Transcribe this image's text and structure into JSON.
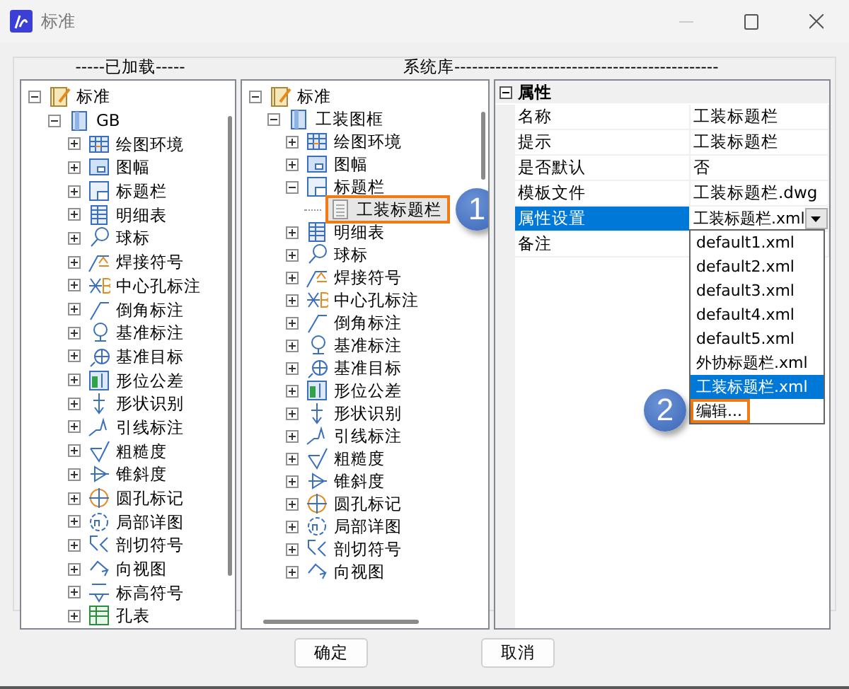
{
  "window": {
    "title": "标准"
  },
  "loaded": {
    "label": "-----已加载-----",
    "tree": [
      {
        "label": "标准",
        "expanded": true,
        "selected": false,
        "children": [
          {
            "label": "GB",
            "expanded": true,
            "selected": false,
            "children": [
              {
                "label": "绘图环境",
                "expanded": false,
                "selected": false
              },
              {
                "label": "图幅",
                "expanded": false,
                "selected": false
              },
              {
                "label": "标题栏",
                "expanded": false,
                "selected": false
              },
              {
                "label": "明细表",
                "expanded": false,
                "selected": false
              },
              {
                "label": "球标",
                "expanded": false,
                "selected": false
              },
              {
                "label": "焊接符号",
                "expanded": false,
                "selected": false
              },
              {
                "label": "中心孔标注",
                "expanded": false,
                "selected": false
              },
              {
                "label": "倒角标注",
                "expanded": false,
                "selected": false
              },
              {
                "label": "基准标注",
                "expanded": false,
                "selected": false
              },
              {
                "label": "基准目标",
                "expanded": false,
                "selected": false
              },
              {
                "label": "形位公差",
                "expanded": false,
                "selected": false
              },
              {
                "label": "形状识别",
                "expanded": false,
                "selected": false
              },
              {
                "label": "引线标注",
                "expanded": false,
                "selected": false
              },
              {
                "label": "粗糙度",
                "expanded": false,
                "selected": false
              },
              {
                "label": "锥斜度",
                "expanded": false,
                "selected": false
              },
              {
                "label": "圆孔标记",
                "expanded": false,
                "selected": false
              },
              {
                "label": "局部详图",
                "expanded": false,
                "selected": false
              },
              {
                "label": "剖切符号",
                "expanded": false,
                "selected": false
              },
              {
                "label": "向视图",
                "expanded": false,
                "selected": false
              },
              {
                "label": "标高符号",
                "expanded": false,
                "selected": false
              },
              {
                "label": "孔表",
                "expanded": false,
                "selected": false
              }
            ]
          }
        ]
      }
    ]
  },
  "library": {
    "label": "系统库---------------------------------------------",
    "tree": [
      {
        "label": "标准",
        "expanded": true,
        "selected": false,
        "children": [
          {
            "label": "工装图框",
            "expanded": true,
            "selected": false,
            "children": [
              {
                "label": "绘图环境",
                "expanded": false,
                "selected": false
              },
              {
                "label": "图幅",
                "expanded": false,
                "selected": false
              },
              {
                "label": "标题栏",
                "expanded": true,
                "selected": false,
                "children": [
                  {
                    "label": "工装标题栏",
                    "selected": true,
                    "callout": "1"
                  }
                ]
              },
              {
                "label": "明细表",
                "expanded": false,
                "selected": false
              },
              {
                "label": "球标",
                "expanded": false,
                "selected": false
              },
              {
                "label": "焊接符号",
                "expanded": false,
                "selected": false
              },
              {
                "label": "中心孔标注",
                "expanded": false,
                "selected": false
              },
              {
                "label": "倒角标注",
                "expanded": false,
                "selected": false
              },
              {
                "label": "基准标注",
                "expanded": false,
                "selected": false
              },
              {
                "label": "基准目标",
                "expanded": false,
                "selected": false
              },
              {
                "label": "形位公差",
                "expanded": false,
                "selected": false
              },
              {
                "label": "形状识别",
                "expanded": false,
                "selected": false
              },
              {
                "label": "引线标注",
                "expanded": false,
                "selected": false
              },
              {
                "label": "粗糙度",
                "expanded": false,
                "selected": false
              },
              {
                "label": "锥斜度",
                "expanded": false,
                "selected": false
              },
              {
                "label": "圆孔标记",
                "expanded": false,
                "selected": false
              },
              {
                "label": "局部详图",
                "expanded": false,
                "selected": false
              },
              {
                "label": "剖切符号",
                "expanded": false,
                "selected": false
              },
              {
                "label": "向视图",
                "expanded": false,
                "selected": false
              }
            ]
          }
        ]
      }
    ]
  },
  "properties": {
    "title": "属性",
    "expanded": true,
    "rows": [
      {
        "name": "名称",
        "value": "工装标题栏",
        "selected": false
      },
      {
        "name": "提示",
        "value": "工装标题栏",
        "selected": false
      },
      {
        "name": "是否默认",
        "value": "否",
        "selected": false
      },
      {
        "name": "模板文件",
        "value": "工装标题栏.dwg",
        "selected": false
      },
      {
        "name": "属性设置",
        "value": "工装标题栏.xml",
        "selected": true,
        "dropdown": [
          {
            "label": "default1.xml",
            "selected": false
          },
          {
            "label": "default2.xml",
            "selected": false
          },
          {
            "label": "default3.xml",
            "selected": false
          },
          {
            "label": "default4.xml",
            "selected": false
          },
          {
            "label": "default5.xml",
            "selected": false
          },
          {
            "label": "外协标题栏.xml",
            "selected": false
          },
          {
            "label": "工装标题栏.xml",
            "selected": true
          },
          {
            "label": "编辑...",
            "selected": false,
            "callout": "2"
          }
        ]
      },
      {
        "name": "备注",
        "value": "",
        "selected": false
      }
    ]
  },
  "buttons": [
    {
      "label": "确定"
    },
    {
      "label": "取消"
    }
  ]
}
